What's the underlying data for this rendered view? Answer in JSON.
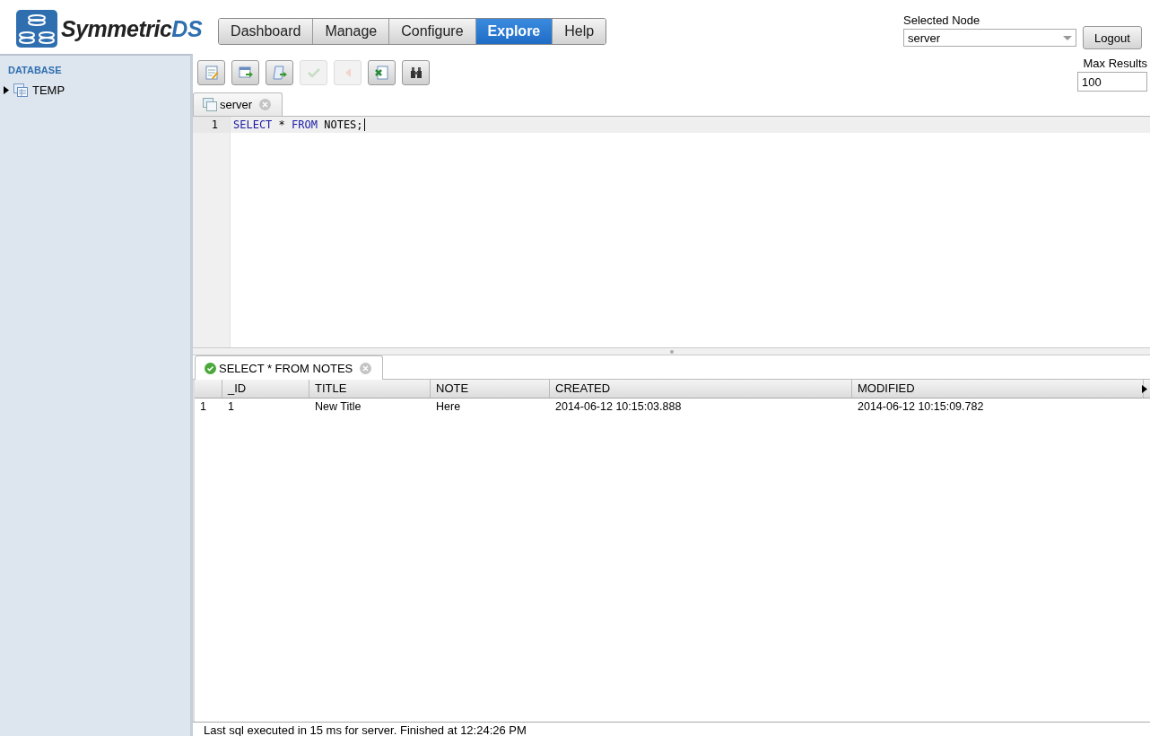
{
  "header": {
    "logo": {
      "name": "Symmetric",
      "suffix": "DS"
    },
    "nav": [
      {
        "label": "Dashboard",
        "selected": false
      },
      {
        "label": "Manage",
        "selected": false
      },
      {
        "label": "Configure",
        "selected": false
      },
      {
        "label": "Explore",
        "selected": true
      },
      {
        "label": "Help",
        "selected": false
      }
    ],
    "node_select": {
      "label": "Selected Node",
      "value": "server"
    },
    "logout": "Logout"
  },
  "sidebar": {
    "heading": "DATABASE",
    "items": [
      {
        "label": "TEMP",
        "expanded": false
      }
    ]
  },
  "toolbar": [
    {
      "kind": "edit",
      "disabled": false
    },
    {
      "kind": "execute",
      "disabled": false
    },
    {
      "kind": "script",
      "disabled": false
    },
    {
      "kind": "commit",
      "disabled": true
    },
    {
      "kind": "rollback",
      "disabled": true
    },
    {
      "kind": "export",
      "disabled": false
    },
    {
      "kind": "find",
      "disabled": false
    }
  ],
  "max_results": {
    "label": "Max Results",
    "value": "100"
  },
  "editor": {
    "tab": "server",
    "lines": [
      {
        "number": "1",
        "tokens": [
          {
            "text": "SELECT",
            "kind": "keyword"
          },
          {
            "text": "*",
            "kind": "plain"
          },
          {
            "text": "FROM",
            "kind": "keyword"
          },
          {
            "text": "NOTES;",
            "kind": "plain"
          }
        ]
      }
    ]
  },
  "results": {
    "tab": "SELECT * FROM NOTES",
    "columns": [
      "",
      "_ID",
      "TITLE",
      "NOTE",
      "CREATED",
      "MODIFIED"
    ],
    "rows": [
      [
        "1",
        "1",
        "New Title",
        "Here",
        "2014-06-12 10:15:03.888",
        "2014-06-12 10:15:09.782"
      ]
    ]
  },
  "status_bar": "Last sql executed in 15 ms for server. Finished at 12:24:26 PM"
}
